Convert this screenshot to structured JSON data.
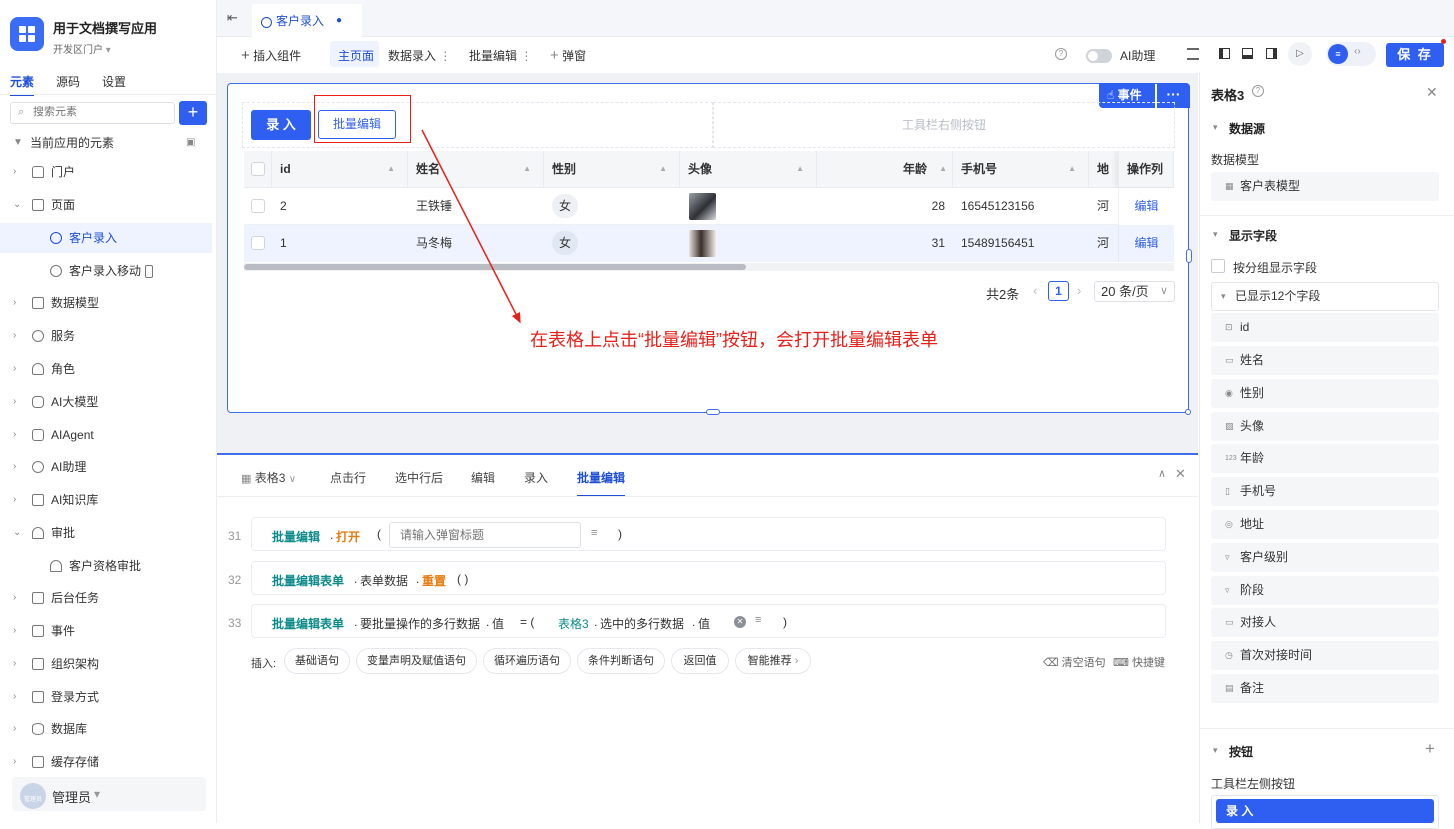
{
  "app": {
    "name": "用于文档撰写应用",
    "env": "开发区门户"
  },
  "side_tabs": [
    "元素",
    "源码",
    "设置"
  ],
  "search": {
    "placeholder": "搜索元素"
  },
  "tree": {
    "header": "当前应用的元素",
    "items": [
      {
        "label": "门户"
      },
      {
        "label": "页面"
      },
      {
        "label": "客户录入"
      },
      {
        "label": "客户录入移动"
      },
      {
        "label": "数据模型"
      },
      {
        "label": "服务"
      },
      {
        "label": "角色"
      },
      {
        "label": "AI大模型"
      },
      {
        "label": "AIAgent"
      },
      {
        "label": "AI助理"
      },
      {
        "label": "AI知识库"
      },
      {
        "label": "审批"
      },
      {
        "label": "客户资格审批"
      },
      {
        "label": "后台任务"
      },
      {
        "label": "事件"
      },
      {
        "label": "组织架构"
      },
      {
        "label": "登录方式"
      },
      {
        "label": "数据库"
      },
      {
        "label": "缓存存储"
      }
    ]
  },
  "user": {
    "name": "管理员",
    "avatar_text": "管理员"
  },
  "doc_tab": {
    "label": "客户录入"
  },
  "toolbar": {
    "insert": "插入组件",
    "main_page": "主页面",
    "data_entry": "数据录入",
    "batch_edit": "批量编辑",
    "popup": "弹窗",
    "ai_assist": "AI助理",
    "save": "保 存"
  },
  "table_card": {
    "event_btn": "事件",
    "btn_entry": "录 入",
    "btn_batch": "批量编辑",
    "right_toolbar": "工具栏右侧按钮",
    "columns": [
      "id",
      "姓名",
      "性别",
      "头像",
      "年龄",
      "手机号",
      "地址",
      "操作列"
    ],
    "rows": [
      {
        "id": "2",
        "name": "王铁锤",
        "gender": "女",
        "age": "28",
        "phone": "16545123156",
        "addr": "河北",
        "op": "编辑"
      },
      {
        "id": "1",
        "name": "马冬梅",
        "gender": "女",
        "age": "31",
        "phone": "15489156451",
        "addr": "河北",
        "op": "编辑"
      }
    ],
    "total": "共2条",
    "page": "1",
    "page_size": "20 条/页",
    "annotation": "在表格上点击“批量编辑”按钮，会打开批量编辑表单"
  },
  "bottom": {
    "tabs": [
      "表格3",
      "点击行",
      "选中行后",
      "编辑",
      "录入",
      "批量编辑"
    ],
    "lines": [
      {
        "num": "31",
        "a": "批量编辑",
        "b": "打开",
        "placeholder": "请输入弹窗标题"
      },
      {
        "num": "32",
        "a": "批量编辑表单",
        "b": "表单数据",
        "c": "重置",
        "d": "( )"
      },
      {
        "num": "33",
        "a": "批量编辑表单",
        "b": "要批量操作的多行数据",
        "c": "值",
        "d": "表格3",
        "e": "选中的多行数据",
        "f": "值"
      }
    ],
    "insert_label": "插入:",
    "pills": [
      "基础语句",
      "变量声明及赋值语句",
      "循环遍历语句",
      "条件判断语句",
      "返回值",
      "智能推荐"
    ],
    "clear": "清空语句",
    "shortcut": "快捷键"
  },
  "right": {
    "title": "表格3",
    "datasource": "数据源",
    "data_model_label": "数据模型",
    "data_model_value": "客户表模型",
    "display_fields": "显示字段",
    "group_display": "按分组显示字段",
    "shown": "已显示12个字段",
    "fields": [
      "id",
      "姓名",
      "性别",
      "头像",
      "年龄",
      "手机号",
      "地址",
      "客户级别",
      "阶段",
      "对接人",
      "首次对接时间",
      "备注"
    ],
    "buttons": "按钮",
    "toolbar_left": "工具栏左侧按钮",
    "entry_btn": "录 入"
  },
  "colors": {
    "accent": "#2f5ff0",
    "annotation": "#e8201a",
    "teal": "#0d8b8b",
    "orange": "#e67b10"
  }
}
